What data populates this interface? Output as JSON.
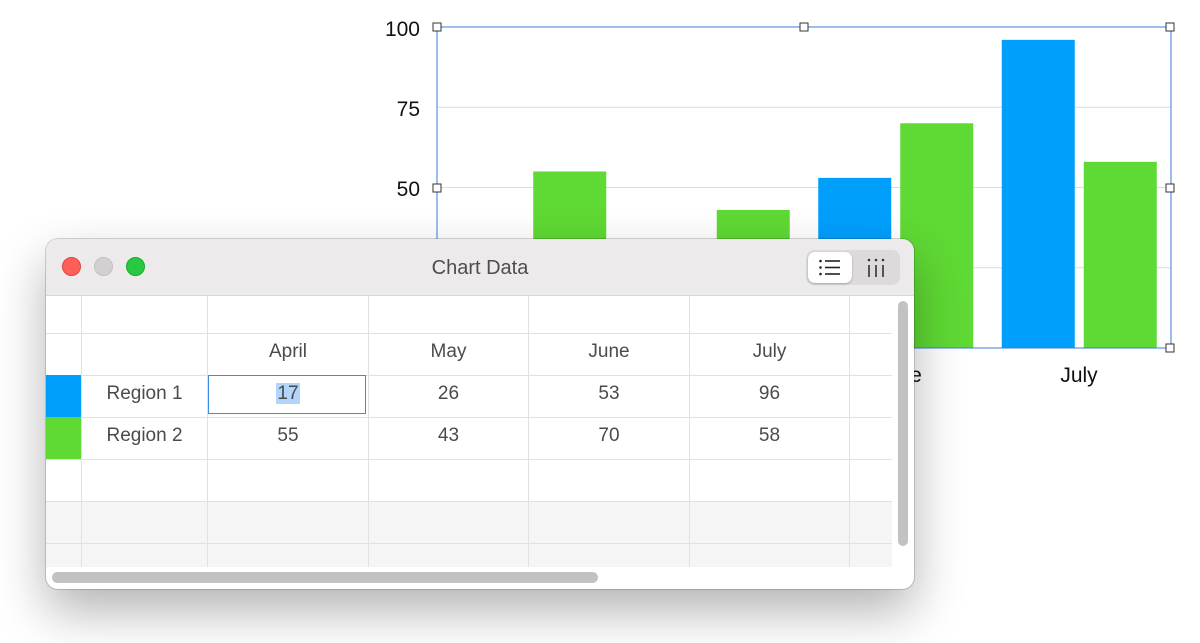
{
  "chart_data": {
    "type": "bar",
    "categories": [
      "April",
      "May",
      "June",
      "July"
    ],
    "series": [
      {
        "name": "Region 1",
        "values": [
          17,
          26,
          53,
          96
        ],
        "color": "#009ffc"
      },
      {
        "name": "Region 2",
        "values": [
          55,
          43,
          70,
          58
        ],
        "color": "#5fd934"
      }
    ],
    "y_ticks": [
      "100",
      "75",
      "50"
    ],
    "visible_category_labels": [
      "e",
      "July"
    ],
    "ylim": [
      0,
      100
    ],
    "grid": true
  },
  "window": {
    "title": "Chart Data",
    "view_toggle": [
      {
        "name": "list-icon",
        "selected": true
      },
      {
        "name": "columns-icon",
        "selected": false
      }
    ]
  },
  "table": {
    "columns": [
      "April",
      "May",
      "June",
      "July"
    ],
    "rows": [
      {
        "label": "Region 1",
        "color": "#009ffc",
        "values": [
          "17",
          "26",
          "53",
          "96"
        ]
      },
      {
        "label": "Region 2",
        "color": "#5fd934",
        "values": [
          "55",
          "43",
          "70",
          "58"
        ]
      }
    ],
    "selected_cell": "17"
  }
}
